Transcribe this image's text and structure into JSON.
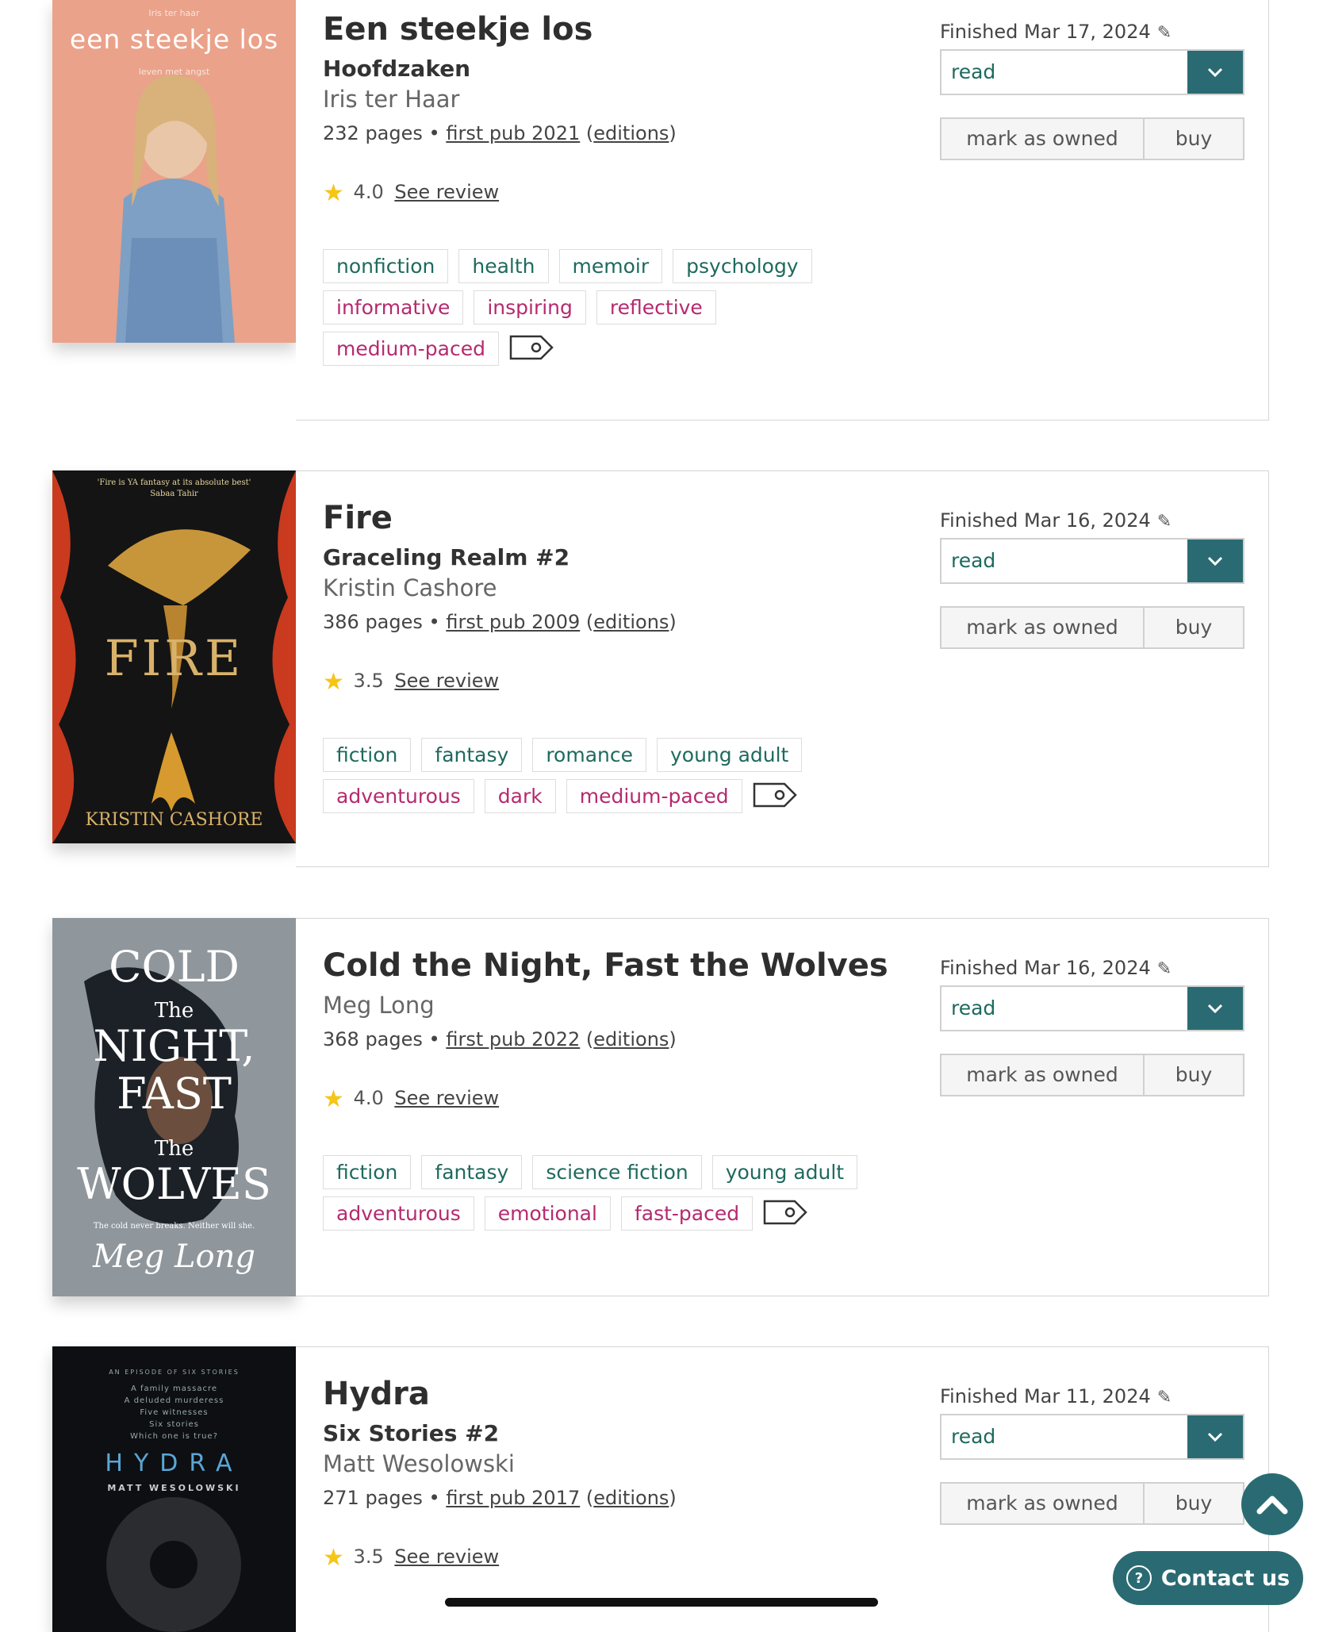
{
  "books": [
    {
      "title": "Een steekje los",
      "series": "Hoofdzaken",
      "author": "Iris ter Haar",
      "pages": "232 pages",
      "first_pub": "first pub 2021",
      "editions": "editions",
      "rating": "4.0",
      "review_link": "See review",
      "finished": "Finished Mar 17, 2024",
      "shelf": "read",
      "owned_label": "mark as owned",
      "buy_label": "buy",
      "genre_tags": [
        "nonfiction",
        "health",
        "memoir",
        "psychology"
      ],
      "mood_tags": [
        "informative",
        "inspiring",
        "reflective",
        "medium-paced"
      ],
      "cover": {
        "top_text": "Iris ter haar",
        "title": "een steekje los",
        "subtitle": "leven met angst"
      }
    },
    {
      "title": "Fire",
      "series": "Graceling Realm #2",
      "author": "Kristin Cashore",
      "pages": "386 pages",
      "first_pub": "first pub 2009",
      "editions": "editions",
      "rating": "3.5",
      "review_link": "See review",
      "finished": "Finished Mar 16, 2024",
      "shelf": "read",
      "owned_label": "mark as owned",
      "buy_label": "buy",
      "genre_tags": [
        "fiction",
        "fantasy",
        "romance",
        "young adult"
      ],
      "mood_tags": [
        "adventurous",
        "dark",
        "medium-paced"
      ],
      "cover": {
        "quote": "'Fire is YA fantasy at its absolute best'",
        "quote_by": "Sabaa Tahir",
        "title": "FIRE",
        "author": "KRISTIN CASHORE"
      }
    },
    {
      "title": "Cold the Night, Fast the Wolves",
      "author": "Meg Long",
      "pages": "368 pages",
      "first_pub": "first pub 2022",
      "editions": "editions",
      "rating": "4.0",
      "review_link": "See review",
      "finished": "Finished Mar 16, 2024",
      "shelf": "read",
      "owned_label": "mark as owned",
      "buy_label": "buy",
      "genre_tags": [
        "fiction",
        "fantasy",
        "science fiction",
        "young adult"
      ],
      "mood_tags": [
        "adventurous",
        "emotional",
        "fast-paced"
      ],
      "cover": {
        "l1": "COLD",
        "l2": "The",
        "l3": "NIGHT,",
        "l4": "FAST",
        "l5": "The",
        "l6": "WOLVES",
        "tagline": "The cold never breaks. Neither will she.",
        "author": "Meg Long"
      }
    },
    {
      "title": "Hydra",
      "series": "Six Stories #2",
      "author": "Matt Wesolowski",
      "pages": "271 pages",
      "first_pub": "first pub 2017",
      "editions": "editions",
      "rating": "3.5",
      "review_link": "See review",
      "finished": "Finished Mar 11, 2024",
      "shelf": "read",
      "owned_label": "mark as owned",
      "buy_label": "buy",
      "cover": {
        "top": "AN EPISODE OF SIX STORIES",
        "lines": [
          "A family massacre",
          "A deluded murderess",
          "Five witnesses",
          "Six stories",
          "Which one is true?"
        ],
        "title": "HYDRA",
        "author": "MATT WESOLOWSKI"
      }
    }
  ],
  "contact_label": "Contact us",
  "colors": {
    "accent": "#2a6b73",
    "genre": "#1e6a5e",
    "mood": "#b52a6f"
  }
}
